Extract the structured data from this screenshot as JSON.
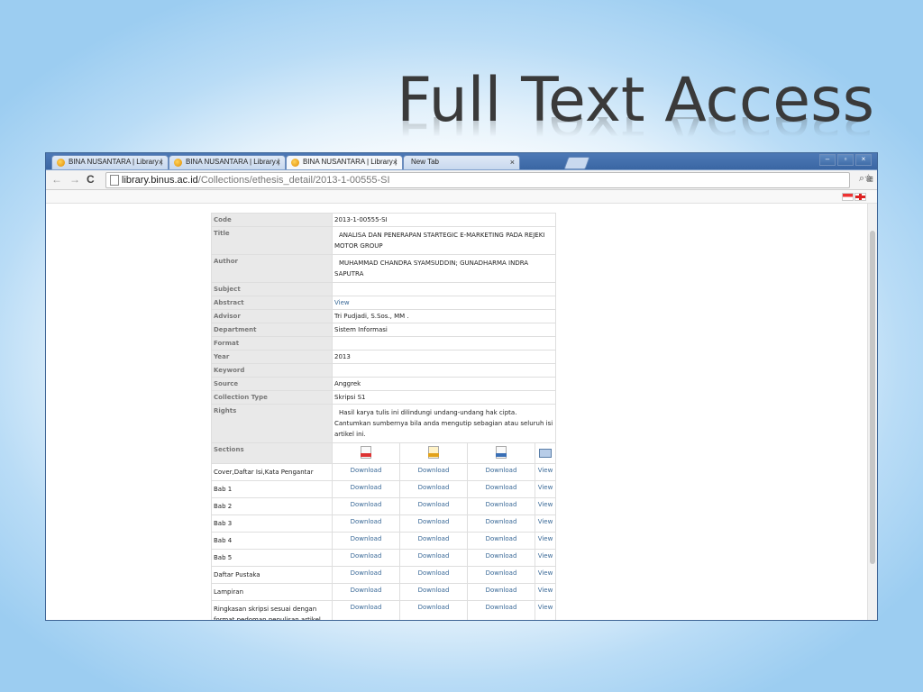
{
  "slide": {
    "title": "Full Text Access"
  },
  "browser": {
    "tabs": [
      {
        "label": "BINA NUSANTARA | Library |"
      },
      {
        "label": "BINA NUSANTARA | Library |"
      },
      {
        "label": "BINA NUSANTARA | Library |"
      },
      {
        "label": "New Tab"
      }
    ],
    "address": {
      "host": "library.binus.ac.id",
      "path": "/Collections/ethesis_detail/2013-1-00555-SI"
    }
  },
  "detail": {
    "fields": [
      {
        "label": "Code",
        "value": "2013-1-00555-SI"
      },
      {
        "label": "Title",
        "value": "ANALISA DAN PENERAPAN STARTEGIC E-MARKETING PADA REJEKI MOTOR GROUP"
      },
      {
        "label": "Author",
        "value": "MUHAMMAD CHANDRA SYAMSUDDIN; GUNADHARMA INDRA SAPUTRA"
      },
      {
        "label": "Subject",
        "value": ""
      },
      {
        "label": "Abstract",
        "value": "View"
      },
      {
        "label": "Advisor",
        "value": "Tri Pudjadi, S.Sos., MM ."
      },
      {
        "label": "Department",
        "value": "Sistem Informasi"
      },
      {
        "label": "Format",
        "value": ""
      },
      {
        "label": "Year",
        "value": "2013"
      },
      {
        "label": "Keyword",
        "value": ""
      },
      {
        "label": "Source",
        "value": "Anggrek"
      },
      {
        "label": "Collection Type",
        "value": "Skripsi S1"
      },
      {
        "label": "Rights",
        "value": "Hasil karya tulis ini dilindungi undang-undang hak cipta. Cantumkan sumbernya bila anda mengutip sebagian atau seluruh isi artikel ini."
      }
    ],
    "sections_label": "Sections",
    "icons": [
      "pdf-icon",
      "zip-icon",
      "doc-icon",
      "image-view-icon"
    ],
    "sections": [
      {
        "name": "Cover,Daftar Isi,Kata Pengantar",
        "d1": "Download",
        "d2": "Download",
        "d3": "Download",
        "view": "View"
      },
      {
        "name": "Bab 1",
        "d1": "Download",
        "d2": "Download",
        "d3": "Download",
        "view": "View"
      },
      {
        "name": "Bab 2",
        "d1": "Download",
        "d2": "Download",
        "d3": "Download",
        "view": "View"
      },
      {
        "name": "Bab 3",
        "d1": "Download",
        "d2": "Download",
        "d3": "Download",
        "view": "View"
      },
      {
        "name": "Bab 4",
        "d1": "Download",
        "d2": "Download",
        "d3": "Download",
        "view": "View"
      },
      {
        "name": "Bab 5",
        "d1": "Download",
        "d2": "Download",
        "d3": "Download",
        "view": "View"
      },
      {
        "name": "Daftar Pustaka",
        "d1": "Download",
        "d2": "Download",
        "d3": "Download",
        "view": "View"
      },
      {
        "name": "Lampiran",
        "d1": "Download",
        "d2": "Download",
        "d3": "Download",
        "view": "View"
      },
      {
        "name": "Ringkasan skripsi sesuai dengan format pedoman penulisan artikel ilmiah",
        "d1": "Download",
        "d2": "Download",
        "d3": "Download",
        "view": "View"
      }
    ]
  }
}
